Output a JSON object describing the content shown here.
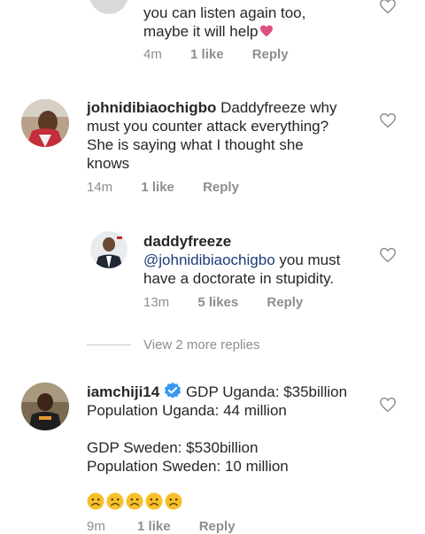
{
  "comments": [
    {
      "text_lines": [
        "you can listen again too,",
        "maybe it will help"
      ],
      "trailing_emoji": "pink-heart-emoji",
      "time": "4m",
      "likes": "1 like",
      "reply": "Reply"
    },
    {
      "username": "johnidibiaochigbo",
      "text_first": " Daddyfreeze why",
      "text_lines": [
        "must you counter attack everything?",
        "She is saying what I thought she",
        "knows"
      ],
      "time": "14m",
      "likes": "1 like",
      "reply": "Reply"
    },
    {
      "username": "daddyfreeze",
      "mention": "@johnidibiaochigbo",
      "text_first": " you must",
      "text_lines": [
        "have a doctorate in stupidity."
      ],
      "time": "13m",
      "likes": "5 likes",
      "reply": "Reply"
    },
    {
      "username": "iamchiji14",
      "verified": true,
      "text_first": " GDP Uganda: $35billion",
      "text_lines": [
        "Population Uganda: 44 million",
        "",
        "GDP Sweden: $530billion",
        "Population Sweden: 10 million"
      ],
      "emoji_row": [
        "frowning-face-emoji",
        "frowning-face-emoji",
        "frowning-face-emoji",
        "frowning-face-emoji",
        "frowning-face-emoji"
      ],
      "time": "9m",
      "likes": "1 like",
      "reply": "Reply"
    }
  ],
  "view_more_replies": "View 2 more replies",
  "colors": {
    "mention": "#1d3c78",
    "meta": "#8e8e8e",
    "verified": "#3897f0",
    "heart": "#e0507f",
    "emoji": "#f7c02a"
  }
}
